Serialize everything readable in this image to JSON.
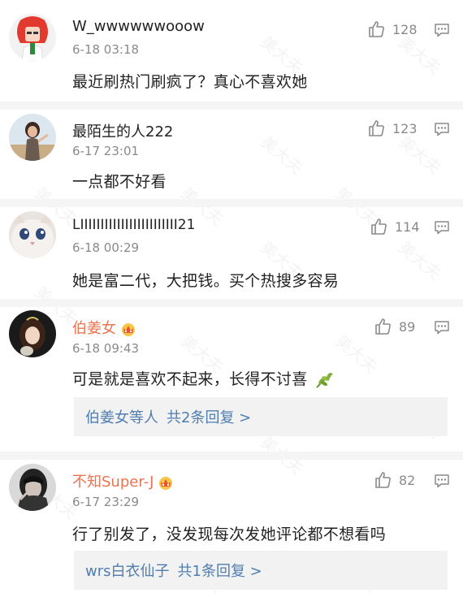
{
  "comments": [
    {
      "username": "W_wwwwwwooow",
      "time": "6-18 03:18",
      "likes": "128",
      "text": "最近刷热门刷疯了？真心不喜欢她",
      "vip": false
    },
    {
      "username": "最陌生的人222",
      "time": "6-17 23:01",
      "likes": "123",
      "text": "一点都不好看",
      "vip": false
    },
    {
      "username": "LIIIIIIIIIIIIIIIIIIIIIIII21",
      "time": "6-18 00:29",
      "likes": "114",
      "text": "她是富二代，大把钱。买个热搜多容易",
      "vip": false
    },
    {
      "username": "伯姜女",
      "time": "6-18 09:43",
      "likes": "89",
      "text": "可是就是喜欢不起来，长得不讨喜",
      "vip": true,
      "emoji": "leaf-emoji",
      "reply": {
        "name": "伯姜女",
        "suffix": "等人",
        "count": "共2条回复 >"
      }
    },
    {
      "username": "不知Super-J",
      "time": "6-17 23:29",
      "likes": "82",
      "text": "行了别发了，没发现每次发她评论都不想看吗",
      "vip": true,
      "reply": {
        "name": "wrs白衣仙子",
        "suffix": "",
        "count": "共1条回复 >"
      }
    }
  ],
  "watermark": "美大夫",
  "icons": {
    "like": "thumbs-up-icon",
    "more": "more-dots-icon",
    "vip": "crown-icon"
  },
  "colors": {
    "text": "#222222",
    "meta": "#8a8a8a",
    "vip_name": "#eb7350",
    "reply_link": "#507daf",
    "reply_bg": "#f2f2f2",
    "separator": "#f5f5f5"
  }
}
